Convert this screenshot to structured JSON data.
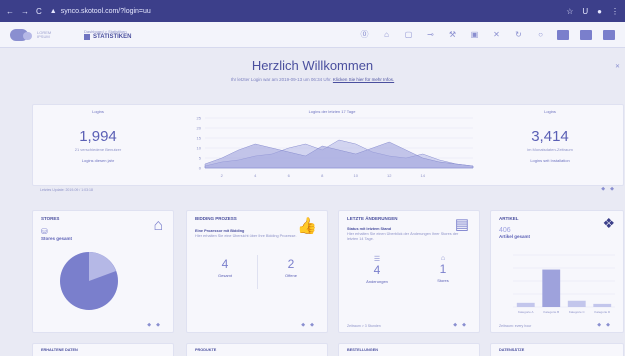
{
  "browser": {
    "url": "synco.skotool.com/?login=uu"
  },
  "header": {
    "logo_text": "LOREM IPSUM",
    "breadcrumb": "Dashboard > Statistiken",
    "page_title": "STATISTIKEN"
  },
  "welcome": {
    "title": "Herzlich Willkommen",
    "last_login": "Ihr letzter Login war am 2019-09-13 um 06:34 Uhr.",
    "more_info": "Klicken Sie hier für mehr Infos."
  },
  "stats": {
    "logins_label": "Logins",
    "logins_value": "1,994",
    "logins_caption": "21 verschiedene Benutzer",
    "logins_footer": "Logins diesen jahr",
    "chart_label": "Logins der letzten 17 Tage",
    "right_label": "Logins",
    "right_value": "3,414",
    "right_caption": "im Monatsdaten-Zeitraum",
    "right_footer": "Logins seit Installation",
    "updated": "Letztes Update: 2019-09 / 1:03:18"
  },
  "chart_data": {
    "type": "area",
    "x": [
      1,
      2,
      3,
      4,
      5,
      6,
      7,
      8,
      9,
      10,
      11,
      12,
      13,
      14,
      15,
      16,
      17
    ],
    "xticks": [
      "2",
      "4",
      "6",
      "8",
      "10",
      "12",
      "14"
    ],
    "ylim": [
      0,
      25
    ],
    "yticks": [
      "0",
      "5",
      "10",
      "15",
      "20",
      "25"
    ],
    "series": [
      {
        "values": [
          1,
          3,
          4,
          6,
          7,
          10,
          12,
          9,
          14,
          12,
          8,
          6,
          5,
          7,
          4,
          2,
          1
        ]
      },
      {
        "values": [
          2,
          5,
          9,
          12,
          10,
          8,
          6,
          11,
          9,
          7,
          10,
          13,
          9,
          5,
          3,
          2,
          1
        ]
      }
    ]
  },
  "cards": {
    "stores": {
      "title": "STORES",
      "count_label": "Stores gesamt",
      "pie": [
        0.8,
        0.2
      ]
    },
    "bidding": {
      "title": "BIDDING PROZESS",
      "line1": "Eine Prozessor mit Bidding",
      "line2": "Hier erhalten Sie eine Übersicht über Ihre Bidding Prozesse.",
      "left_value": "4",
      "left_label": "Gesamt",
      "right_value": "2",
      "right_label": "Offene"
    },
    "orders": {
      "title": "LETZTE ÄNDERUNGEN",
      "line1": "Status mit letztem Stand",
      "line2": "Hier erhalten Sie einen Überblick der Änderungen Ihrer Stores der letzten 14 Tage.",
      "left_value": "4",
      "left_label": "Änderungen",
      "right_value": "1",
      "right_label": "Stores",
      "footer": "Zeitraum > 3 Stunden"
    },
    "articles": {
      "title": "ARTIKEL",
      "value": "406",
      "value_label": "Artikel gesamt",
      "footer": "Zeitraum: every hour"
    }
  },
  "bars": {
    "type": "bar",
    "categories": [
      "Kategorie A",
      "Kategorie B",
      "Kategorie C",
      "Kategorie D"
    ],
    "values": [
      8,
      72,
      12,
      6
    ],
    "ylim": [
      0,
      100
    ]
  },
  "bottom": {
    "c1": "ERHALTENE DATEN",
    "c2": "PRODUKTE",
    "c3": "BESTELLUNGEN",
    "c4": "DATENSÄTZE"
  }
}
